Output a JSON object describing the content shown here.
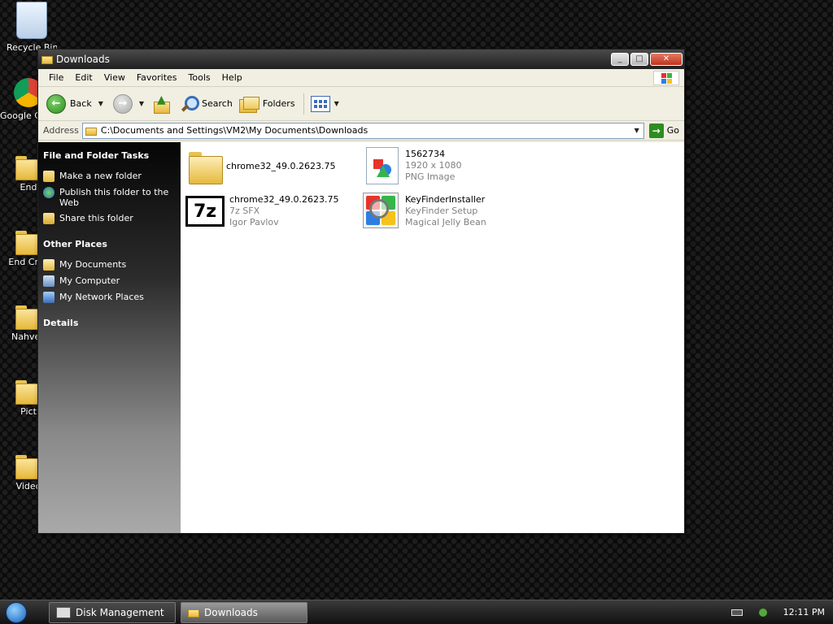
{
  "desktop": {
    "icons": [
      {
        "label": "Recycle Bin"
      },
      {
        "label": "Google Chrome"
      },
      {
        "label": "End"
      },
      {
        "label": "End Crec"
      },
      {
        "label": "Nahvee"
      },
      {
        "label": "Pict"
      },
      {
        "label": "Video"
      }
    ]
  },
  "window": {
    "title": "Downloads",
    "controls": {
      "minimize": "_",
      "maximize": "□",
      "close": "✕"
    }
  },
  "menubar": {
    "items": [
      "File",
      "Edit",
      "View",
      "Favorites",
      "Tools",
      "Help"
    ]
  },
  "toolbar": {
    "back_label": "Back",
    "search_label": "Search",
    "folders_label": "Folders"
  },
  "address": {
    "label": "Address",
    "value": "C:\\Documents and Settings\\VM2\\My Documents\\Downloads",
    "go_label": "Go"
  },
  "taskpane": {
    "file_tasks": {
      "heading": "File and Folder Tasks",
      "items": [
        "Make a new folder",
        "Publish this folder to the Web",
        "Share this folder"
      ]
    },
    "other_places": {
      "heading": "Other Places",
      "items": [
        "My Documents",
        "My Computer",
        "My Network Places"
      ]
    },
    "details": {
      "heading": "Details"
    }
  },
  "files": [
    {
      "name": "chrome32_49.0.2623.75",
      "line2": "",
      "line3": "",
      "icon": "folder-icon"
    },
    {
      "name": "1562734",
      "line2": "1920 x 1080",
      "line3": "PNG Image",
      "icon": "png-image-icon"
    },
    {
      "name": "chrome32_49.0.2623.75",
      "line2": "7z SFX",
      "line3": "Igor Pavlov",
      "icon": "7z-sfx-icon"
    },
    {
      "name": "KeyFinderInstaller",
      "line2": "KeyFinder Setup",
      "line3": "Magical Jelly Bean",
      "icon": "keyfinder-icon"
    }
  ],
  "taskbar": {
    "tasks": [
      {
        "label": "Disk Management",
        "active": false
      },
      {
        "label": "Downloads",
        "active": true
      }
    ],
    "clock": "12:11 PM"
  }
}
